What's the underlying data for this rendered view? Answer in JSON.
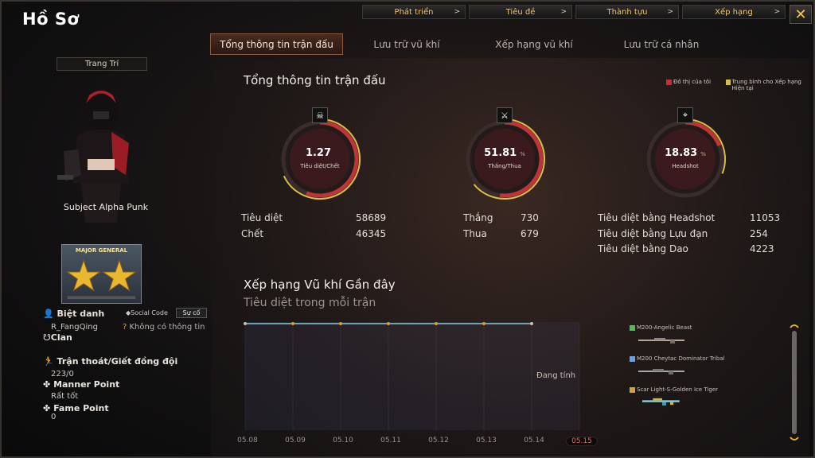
{
  "window": {
    "title": "Hồ Sơ"
  },
  "top_nav": [
    {
      "label": "Phát triển",
      "arrow": ">"
    },
    {
      "label": "Tiêu đề",
      "arrow": ">"
    },
    {
      "label": "Thành tựu",
      "arrow": ">"
    },
    {
      "label": "Xếp hạng",
      "arrow": ">"
    }
  ],
  "close_label": "✕",
  "tabs": [
    {
      "label": "Tổng thông tin trận đấu"
    },
    {
      "label": "Lưu trữ vũ khí"
    },
    {
      "label": "Xếp hạng vũ khí"
    },
    {
      "label": "Lưu trữ cá nhân"
    }
  ],
  "profile": {
    "decoration_label": "Trang Trí",
    "character_name": "Subject Alpha Punk",
    "rank_text": "MAJOR GENERAL",
    "nickname_label": "Biệt danh",
    "nickname": "R_FangQing",
    "social_code_label": "Social Code",
    "social_code_button": "Sự cố",
    "no_info": "Không có thông tin",
    "clan_label": "Clan",
    "escape_label": "Trận thoát/Giết đồng đội",
    "escape_value": "223/0",
    "manner_label": "Manner Point",
    "manner_value": "Rất tốt",
    "fame_label": "Fame Point",
    "fame_value": "0"
  },
  "summary": {
    "title": "Tổng thông tin trận đấu",
    "legend": [
      {
        "label": "Đồ thị của tôi",
        "color": "#c0303a"
      },
      {
        "label": "Trung bình cho Xếp hạng Hiện tại",
        "color": "#d8c048"
      }
    ],
    "gauges": [
      {
        "value": "1.27",
        "pct": "",
        "label": "Tiêu diệt/Chết",
        "icon": "skull-icon",
        "fill": 0.56
      },
      {
        "value": "51.81",
        "pct": "%",
        "label": "Thắng/Thua",
        "icon": "crossed-guns-icon",
        "fill": 0.52
      },
      {
        "value": "18.83",
        "pct": "%",
        "label": "Headshot",
        "icon": "rifle-icon",
        "fill": 0.19
      }
    ],
    "stats": [
      {
        "label": "Tiêu diệt",
        "value": "58689"
      },
      {
        "label": "Chết",
        "value": "46345"
      },
      {
        "label": "Thắng",
        "value": "730"
      },
      {
        "label": "Thua",
        "value": "679"
      },
      {
        "label": "Tiêu diệt bằng Headshot",
        "value": "11053"
      },
      {
        "label": "Tiêu diệt bằng Lựu đạn",
        "value": "254"
      },
      {
        "label": "Tiêu diệt bằng Dao",
        "value": "4223"
      }
    ]
  },
  "weapons_section": {
    "title": "Xếp hạng Vũ khí Gần đây",
    "subtitle": "Tiêu diệt trong mỗi trận",
    "status": "Đang tính",
    "dates": [
      "05.08",
      "05.09",
      "05.10",
      "05.11",
      "05.12",
      "05.13",
      "05.14",
      "05.15"
    ],
    "selected_date": "05.15",
    "weapons": [
      {
        "name": "M200-Angelic Beast",
        "color": "#4cc04c"
      },
      {
        "name": "M200 Cheytac Dominator Tribal",
        "color": "#6aa0e0"
      },
      {
        "name": "Scar Light-S-Golden Ice Tiger",
        "color": "#d8a030"
      }
    ]
  },
  "chart_data": {
    "type": "line",
    "title": "Xếp hạng Vũ khí Gần đây",
    "subtitle": "Tiêu diệt trong mỗi trận",
    "x": [
      "05.08",
      "05.09",
      "05.10",
      "05.11",
      "05.12",
      "05.13",
      "05.14",
      "05.15"
    ],
    "series": [
      {
        "values": [
          null,
          null,
          null,
          null,
          null,
          null,
          null,
          null
        ]
      }
    ],
    "grid": true
  }
}
